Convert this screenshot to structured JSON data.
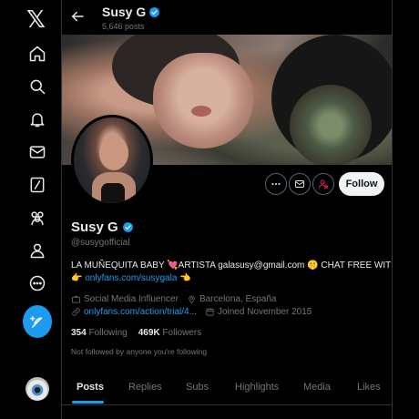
{
  "nav": {
    "logo": "𝕏",
    "items": [
      {
        "name": "home-icon"
      },
      {
        "name": "search-icon"
      },
      {
        "name": "notifications-icon"
      },
      {
        "name": "messages-icon"
      },
      {
        "name": "grok-icon"
      },
      {
        "name": "communities-icon"
      },
      {
        "name": "profile-icon"
      },
      {
        "name": "more-icon"
      }
    ],
    "compose_icon": "feather-plus-icon"
  },
  "header": {
    "name": "Susy G",
    "post_count": "5,646 posts"
  },
  "profile": {
    "name": "Susy G",
    "handle": "@susygofficial",
    "follow_label": "Follow",
    "bio_line1": "LA MUÑEQUITA BABY 💘ARTISTA galasusy@gmail.com 🤫 CHAT FREE WITH ME",
    "bio_line2_prefix": "👉 ",
    "bio_link": "onlyfans.com/susygala",
    "bio_line2_suffix": " 👈",
    "category": "Social Media Influencer",
    "location": "Barcelona, España",
    "website": "onlyfans.com/action/trial/4...",
    "joined": "Joined November 2015",
    "following_count": "354",
    "following_label": "Following",
    "followers_count": "469K",
    "followers_label": "Followers",
    "mutual_note": "Not followed by anyone you're following"
  },
  "tabs": [
    "Posts",
    "Replies",
    "Subs",
    "Highlights",
    "Media",
    "Likes"
  ],
  "colors": {
    "accent": "#1d9bf0",
    "background": "#000000",
    "subscribe_accent": "#f91880"
  }
}
